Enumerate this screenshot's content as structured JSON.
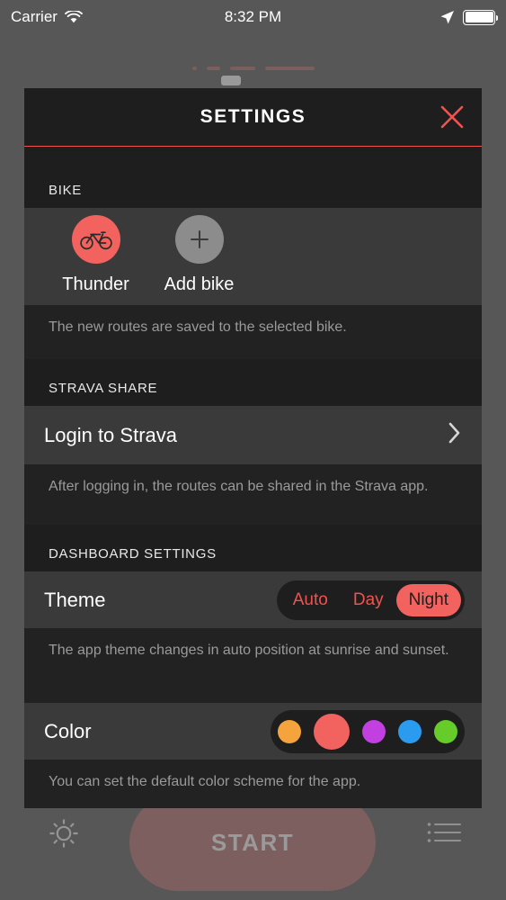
{
  "status_bar": {
    "carrier": "Carrier",
    "wifi_icon": "wifi-icon",
    "time": "8:32 PM",
    "location_icon": "location-arrow-icon",
    "battery_icon": "battery-full-icon"
  },
  "background": {
    "gear_icon": "gear-icon",
    "list_icon": "list-icon",
    "start_label": "START"
  },
  "modal": {
    "title": "SETTINGS",
    "close_icon": "close-icon",
    "accent_color": "#EF5350",
    "sections": {
      "bike": {
        "header": "BIKE",
        "items": [
          {
            "label": "Thunder",
            "icon": "bicycle-icon",
            "color": "#F2635F",
            "selected": true
          },
          {
            "label": "Add bike",
            "icon": "plus-icon",
            "color": "#8C8C8C",
            "selected": false
          }
        ],
        "footer": "The new routes are saved to the selected bike."
      },
      "strava": {
        "header": "STRAVA SHARE",
        "row_label": "Login to Strava",
        "chevron_icon": "chevron-right-icon",
        "footer": "After logging in, the routes can be shared in the Strava app."
      },
      "dashboard": {
        "header": "DASHBOARD SETTINGS",
        "theme": {
          "label": "Theme",
          "options": [
            "Auto",
            "Day",
            "Night"
          ],
          "selected": "Night",
          "footer": "The app theme changes in auto position at sunrise and sunset."
        },
        "color": {
          "label": "Color",
          "swatches": [
            {
              "name": "orange",
              "hex": "#F5A33C",
              "selected": false
            },
            {
              "name": "red",
              "hex": "#F2635F",
              "selected": true
            },
            {
              "name": "purple",
              "hex": "#C23FE0",
              "selected": false
            },
            {
              "name": "blue",
              "hex": "#2B9BF0",
              "selected": false
            },
            {
              "name": "green",
              "hex": "#66CC29",
              "selected": false
            }
          ],
          "footer": "You can set the default color scheme for the app."
        }
      }
    }
  }
}
